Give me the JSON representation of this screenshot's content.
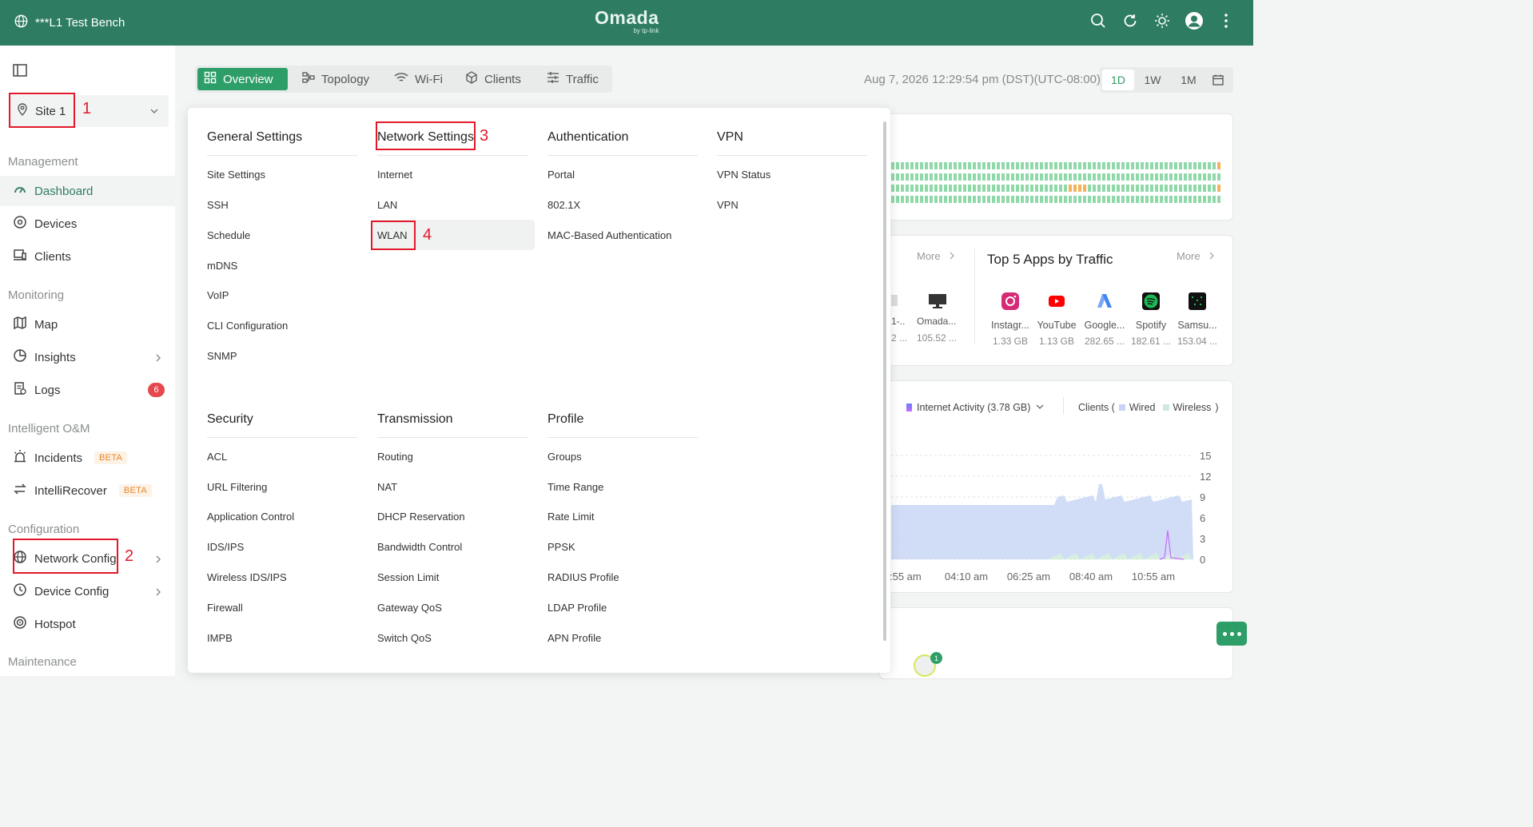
{
  "topbar": {
    "site_name": "***L1 Test Bench",
    "logo": "Omada",
    "logo_sub": "by tp-link"
  },
  "sidebar": {
    "site_select": "Site 1",
    "sections": {
      "management": "Management",
      "monitoring": "Monitoring",
      "intelligent": "Intelligent O&M",
      "configuration": "Configuration",
      "maintenance": "Maintenance"
    },
    "items": {
      "dashboard": "Dashboard",
      "devices": "Devices",
      "clients": "Clients",
      "map": "Map",
      "insights": "Insights",
      "logs": "Logs",
      "logs_badge": "6",
      "incidents": "Incidents",
      "intellirecover": "IntelliRecover",
      "beta": "BETA",
      "network_config": "Network Config",
      "device_config": "Device Config",
      "hotspot": "Hotspot"
    }
  },
  "tabs": {
    "overview": "Overview",
    "topology": "Topology",
    "wifi": "Wi-Fi",
    "clients": "Clients",
    "traffic": "Traffic"
  },
  "date": "Aug 7, 2026 12:29:54 pm (DST)(UTC-08:00)",
  "range": {
    "d": "1D",
    "w": "1W",
    "m": "1M"
  },
  "annotations": {
    "n1": "1",
    "n2": "2",
    "n3": "3",
    "n4": "4"
  },
  "menu": {
    "general": {
      "title": "General Settings",
      "items": [
        "Site Settings",
        "SSH",
        "Schedule",
        "mDNS",
        "VoIP",
        "CLI Configuration",
        "SNMP"
      ]
    },
    "network": {
      "title": "Network Settings",
      "items": [
        "Internet",
        "LAN",
        "WLAN"
      ]
    },
    "auth": {
      "title": "Authentication",
      "items": [
        "Portal",
        "802.1X",
        "MAC-Based Authentication"
      ]
    },
    "vpn": {
      "title": "VPN",
      "items": [
        "VPN Status",
        "VPN"
      ]
    },
    "security": {
      "title": "Security",
      "items": [
        "ACL",
        "URL Filtering",
        "Application Control",
        "IDS/IPS",
        "Wireless IDS/IPS",
        "Firewall",
        "IMPB"
      ]
    },
    "transmission": {
      "title": "Transmission",
      "items": [
        "Routing",
        "NAT",
        "DHCP Reservation",
        "Bandwidth Control",
        "Session Limit",
        "Gateway QoS",
        "Switch QoS"
      ]
    },
    "profile": {
      "title": "Profile",
      "items": [
        "Groups",
        "Time Range",
        "Rate Limit",
        "PPSK",
        "RADIUS Profile",
        "LDAP Profile",
        "APN Profile"
      ]
    }
  },
  "bg": {
    "more": "More",
    "top_apps_title": "Top 5 Apps by Traffic",
    "partial_clients": {
      "name": "Omada...",
      "value": "105.52 ...",
      "cut_name": "1-..",
      "cut_value": "2 ..."
    },
    "apps": [
      {
        "name": "Instagr...",
        "value": "1.33 GB",
        "color": "#d62976"
      },
      {
        "name": "YouTube",
        "value": "1.13 GB",
        "color": "#ff0000"
      },
      {
        "name": "Google...",
        "value": "282.65 ...",
        "color": "#4285f4"
      },
      {
        "name": "Spotify",
        "value": "182.61 ...",
        "color": "#1db954"
      },
      {
        "name": "Samsu...",
        "value": "153.04 ...",
        "color": "#111111"
      }
    ],
    "legend": {
      "internet": "Internet Activity (3.78 GB)",
      "clients": "Clients (",
      "wired": "Wired",
      "wireless": "Wireless",
      "close": ")"
    },
    "y_ticks": [
      "15",
      "12",
      "9",
      "6",
      "3",
      "0"
    ],
    "x_ticks": [
      ":55 am",
      "04:10 am",
      "06:25 am",
      "08:40 am",
      "10:55 am"
    ],
    "bubble": "1"
  }
}
